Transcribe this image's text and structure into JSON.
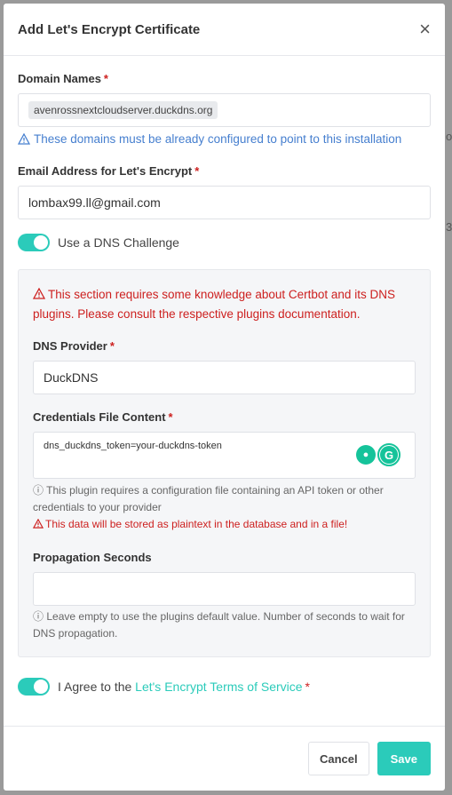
{
  "modal": {
    "title": "Add Let's Encrypt Certificate",
    "close_glyph": "×"
  },
  "domain": {
    "label": "Domain Names",
    "required_marker": "*",
    "tag": "avenrossnextcloudserver.duckdns.org",
    "note": "These domains must be already configured to point to this installation"
  },
  "email": {
    "label": "Email Address for Let's Encrypt",
    "required_marker": "*",
    "value": "lombax99.ll@gmail.com"
  },
  "dns_toggle": {
    "label": "Use a DNS Challenge",
    "checked": true
  },
  "dns_panel": {
    "warning": "This section requires some knowledge about Certbot and its DNS plugins. Please consult the respective plugins documentation.",
    "provider": {
      "label": "DNS Provider",
      "required_marker": "*",
      "value": "DuckDNS"
    },
    "credentials": {
      "label": "Credentials File Content",
      "required_marker": "*",
      "value": "dns_duckdns_token=your-duckdns-token",
      "info": "This plugin requires a configuration file containing an API token or other credentials to your provider",
      "danger": "This data will be stored as plaintext in the database and in a file!"
    },
    "propagation": {
      "label": "Propagation Seconds",
      "value": "",
      "info": "Leave empty to use the plugins default value. Number of seconds to wait for DNS propagation."
    }
  },
  "agree": {
    "prefix": "I Agree to the ",
    "link": "Let's Encrypt Terms of Service",
    "required_marker": "*",
    "checked": true
  },
  "footer": {
    "cancel_label": "Cancel",
    "save_label": "Save"
  },
  "colors": {
    "accent": "#2bcbba",
    "danger": "#cd201f",
    "info": "#467fcf"
  }
}
